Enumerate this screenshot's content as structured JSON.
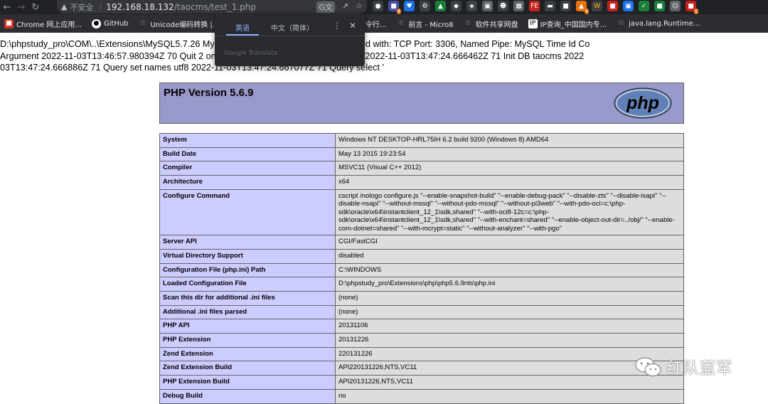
{
  "browser": {
    "back_icon": "back-arrow-icon",
    "forward_icon": "forward-arrow-icon",
    "reload_icon": "reload-icon",
    "security_label": "不安全",
    "url_host": "192.168.18.132",
    "url_path": "/taocms/test_1.php",
    "extension_badges": [
      "4",
      "4",
      "0"
    ]
  },
  "bookmarks": [
    {
      "label": "Chrome 网上应用...",
      "icon": "chrome-store-icon",
      "color": "#d93025"
    },
    {
      "label": "GitHub",
      "icon": "github-icon",
      "color": "#ffffff"
    },
    {
      "label": "Unicode编码转换 |...",
      "icon": "globe-icon",
      "color": "#9aa0a6"
    },
    {
      "label": "sqlmap工具命令行...",
      "icon": "sqlmap-icon",
      "color": "#9aa0a6"
    },
    {
      "label": "前言 - Micro8",
      "icon": "globe-icon",
      "color": "#9aa0a6"
    },
    {
      "label": "软件共享网盘",
      "icon": "globe-icon",
      "color": "#9aa0a6"
    },
    {
      "label": "IP查询_中国国内专...",
      "icon": "ip-icon",
      "color": "#9aa0a6"
    },
    {
      "label": "java.lang.Runtime...",
      "icon": "globe-icon",
      "color": "#9aa0a6"
    }
  ],
  "translate_popup": {
    "tab_english": "英语",
    "tab_chinese": "中文（简体）",
    "brand": "Google Translate"
  },
  "log_lines": [
    "D:\\phpstudy_pro\\COM\\..\\Extensions\\MySQL5.7.26                                                    MySQL Community Server (GPL)). started with: TCP Port: 3306, Named Pipe: MySQL Time Id Co",
    "Argument 2022-11-03T13:46:57.980394Z 70 Quit 2                                                          onnect root@localhost on using TCP/IP 2022-11-03T13:47:24.666462Z 71 Init DB taocms 2022",
    "03T13:47:24.666886Z 71 Query set names utf8 2022-11-03T13:47:24.667077Z 71 Query select '"
  ],
  "php_header": {
    "title": "PHP Version 5.6.9",
    "logo_text": "php"
  },
  "info_rows": [
    {
      "key": "System",
      "value": "Windows NT DESKTOP-HRL75IH 6.2 build 9200 (Windows 8) AMD64"
    },
    {
      "key": "Build Date",
      "value": "May 13 2015 19:23:54"
    },
    {
      "key": "Compiler",
      "value": "MSVC11 (Visual C++ 2012)"
    },
    {
      "key": "Architecture",
      "value": "x64"
    },
    {
      "key": "Configure Command",
      "value": "cscript /nologo configure.js \"--enable-snapshot-build\" \"--enable-debug-pack\" \"--disable-zts\" \"--disable-isapi\" \"--disable-nsapi\" \"--without-mssql\" \"--without-pdo-mssql\" \"--without-pi3web\" \"--with-pdo-oci=c:\\php-sdk\\oracle\\x64\\instantclient_12_1\\sdk,shared\" \"--with-oci8-12c=c:\\php-sdk\\oracle\\x64\\instantclient_12_1\\sdk,shared\" \"--with-enchant=shared\" \"--enable-object-out-dir=../obj/\" \"--enable-com-dotnet=shared\" \"--with-mcrypt=static\" \"--without-analyzer\" \"--with-pgo\""
    },
    {
      "key": "Server API",
      "value": "CGI/FastCGI"
    },
    {
      "key": "Virtual Directory Support",
      "value": "disabled"
    },
    {
      "key": "Configuration File (php.ini) Path",
      "value": "C:\\WINDOWS"
    },
    {
      "key": "Loaded Configuration File",
      "value": "D:\\phpstudy_pro\\Extensions\\php\\php5.6.9nts\\php.ini"
    },
    {
      "key": "Scan this dir for additional .ini files",
      "value": "(none)"
    },
    {
      "key": "Additional .ini files parsed",
      "value": "(none)"
    },
    {
      "key": "PHP API",
      "value": "20131106"
    },
    {
      "key": "PHP Extension",
      "value": "20131226"
    },
    {
      "key": "Zend Extension",
      "value": "220131226"
    },
    {
      "key": "Zend Extension Build",
      "value": "API220131226,NTS,VC11"
    },
    {
      "key": "PHP Extension Build",
      "value": "API20131226,NTS,VC11"
    },
    {
      "key": "Debug Build",
      "value": "no"
    }
  ],
  "watermark": {
    "text": "红队蓝军",
    "icon": "wechat-icon"
  }
}
